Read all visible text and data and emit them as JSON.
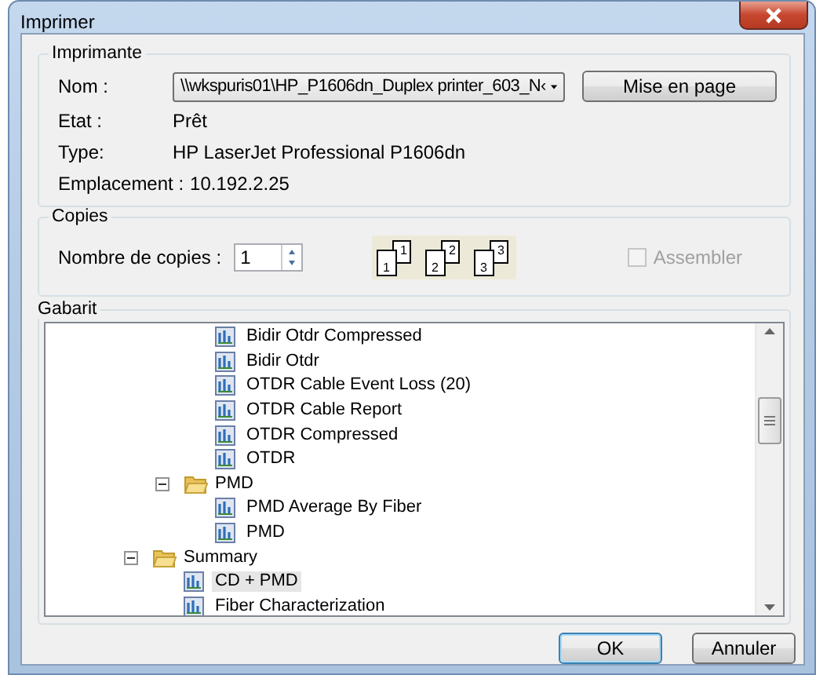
{
  "window": {
    "title": "Imprimer"
  },
  "printer": {
    "legend": "Imprimante",
    "fields": [
      {
        "kind": "dropdown",
        "label": "Nom :",
        "value": "\\\\wkspuris01\\HP_P1606dn_Duplex printer_603_N‹"
      },
      {
        "kind": "text",
        "label": "Etat :",
        "value": "Prêt"
      },
      {
        "kind": "text",
        "label": "Type:",
        "value": "HP LaserJet Professional P1606dn"
      },
      {
        "kind": "text",
        "label": "Emplacement :",
        "value": "10.192.2.25"
      }
    ],
    "setup_button": "Mise en page"
  },
  "copies": {
    "legend": "Copies",
    "label": "Nombre de copies :",
    "value": "1",
    "collate_pages": [
      [
        "1",
        "1"
      ],
      [
        "2",
        "2"
      ],
      [
        "3",
        "3"
      ]
    ],
    "collate": {
      "label": "Assembler",
      "checked": false,
      "disabled": true
    }
  },
  "template": {
    "legend": "Gabarit",
    "items": [
      {
        "children": [
          {
            "children": [
              {
                "kind": "report",
                "label": "Bidir Otdr Compressed",
                "selected": false
              },
              {
                "kind": "report",
                "label": "Bidir Otdr",
                "selected": false
              },
              {
                "kind": "report",
                "label": "OTDR Cable Event Loss (20)",
                "selected": false
              },
              {
                "kind": "report",
                "label": "OTDR Cable Report",
                "selected": false
              },
              {
                "kind": "report",
                "label": "OTDR Compressed",
                "selected": false
              },
              {
                "kind": "report",
                "label": "OTDR",
                "selected": false
              }
            ]
          },
          {
            "kind": "folder",
            "label": "PMD",
            "expanded": true,
            "selected": false,
            "children": [
              {
                "kind": "report",
                "label": "PMD Average By Fiber",
                "selected": false
              },
              {
                "kind": "report",
                "label": "PMD",
                "selected": false
              }
            ]
          }
        ]
      },
      {
        "kind": "folder",
        "label": "Summary",
        "expanded": true,
        "selected": false,
        "children": [
          {
            "kind": "report",
            "label": "CD + PMD",
            "selected": true
          },
          {
            "kind": "report",
            "label": "Fiber Characterization",
            "selected": false
          }
        ]
      }
    ]
  },
  "buttons": [
    {
      "label": "OK",
      "default": true
    },
    {
      "label": "Annuler",
      "default": false
    }
  ]
}
